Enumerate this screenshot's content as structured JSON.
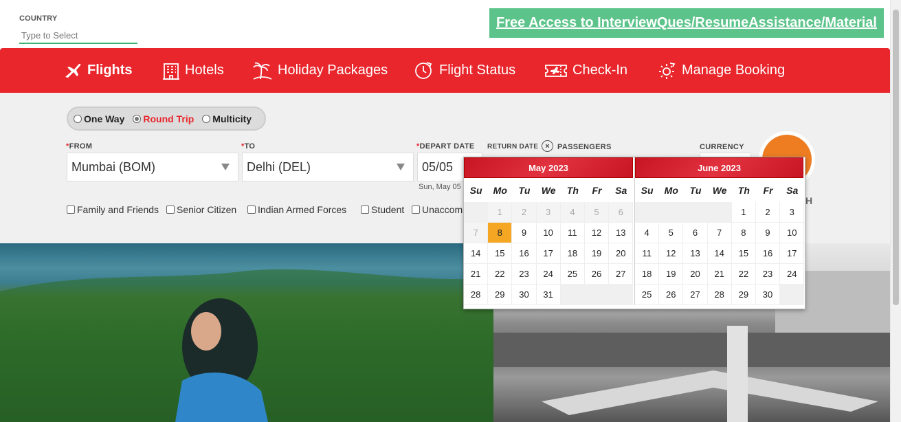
{
  "country": {
    "label": "COUNTRY",
    "placeholder": "Type to Select"
  },
  "promo": {
    "text": "Free Access to InterviewQues/ResumeAssistance/Material",
    "color": "#5cc48a"
  },
  "nav": {
    "color": "#e8262c",
    "items": [
      {
        "label": "Flights",
        "icon": "plane-icon",
        "active": true
      },
      {
        "label": "Hotels",
        "icon": "hotel-icon"
      },
      {
        "label": "Holiday Packages",
        "icon": "palm-tree-icon"
      },
      {
        "label": "Flight Status",
        "icon": "clock-plane-icon"
      },
      {
        "label": "Check-In",
        "icon": "ticket-plane-icon"
      },
      {
        "label": "Manage Booking",
        "icon": "gear-plane-icon"
      }
    ]
  },
  "trip_type": {
    "options": [
      "One Way",
      "Round Trip",
      "Multicity"
    ],
    "selected": "Round Trip"
  },
  "search": {
    "from": {
      "label": "FROM",
      "value": "Mumbai (BOM)"
    },
    "to": {
      "label": "TO",
      "value": "Delhi (DEL)"
    },
    "depart": {
      "label": "DEPART DATE",
      "value": "05/05",
      "sub": "Sun, May 05"
    },
    "return": {
      "label": "RETURN DATE"
    },
    "passengers": {
      "label": "PASSENGERS"
    },
    "currency": {
      "label": "CURRENCY"
    },
    "button_partial": "H"
  },
  "discounts": [
    "Family and Friends",
    "Senior Citizen",
    "Indian Armed Forces",
    "Student",
    "Unaccom"
  ],
  "calendar": {
    "weekdays": [
      "Su",
      "Mo",
      "Tu",
      "We",
      "Th",
      "Fr",
      "Sa"
    ],
    "months": [
      {
        "title": "May 2023",
        "lead_blanks": 1,
        "disabled": [
          "1",
          "2",
          "3",
          "4",
          "5",
          "6",
          "7"
        ],
        "highlight": "8",
        "days": [
          "1",
          "2",
          "3",
          "4",
          "5",
          "6",
          "7",
          "8",
          "9",
          "10",
          "11",
          "12",
          "13",
          "14",
          "15",
          "16",
          "17",
          "18",
          "19",
          "20",
          "21",
          "22",
          "23",
          "24",
          "25",
          "26",
          "27",
          "28",
          "29",
          "30",
          "31"
        ]
      },
      {
        "title": "June 2023",
        "lead_blanks": 4,
        "disabled": [],
        "highlight": null,
        "days": [
          "1",
          "2",
          "3",
          "4",
          "5",
          "6",
          "7",
          "8",
          "9",
          "10",
          "11",
          "12",
          "13",
          "14",
          "15",
          "16",
          "17",
          "18",
          "19",
          "20",
          "21",
          "22",
          "23",
          "24",
          "25",
          "26",
          "27",
          "28",
          "29",
          "30"
        ]
      }
    ]
  }
}
